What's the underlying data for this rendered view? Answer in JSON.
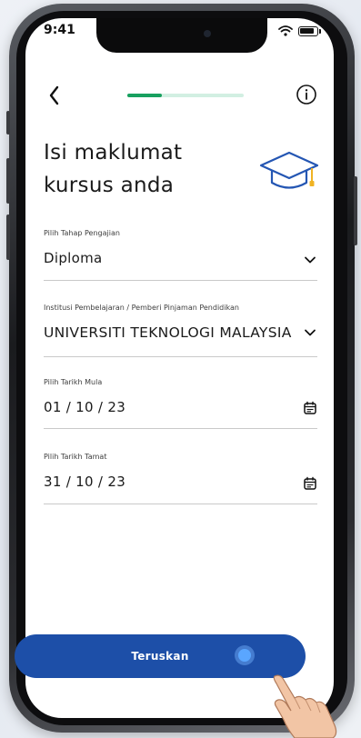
{
  "status_bar": {
    "time": "9:41"
  },
  "progress": {
    "fraction": 0.3
  },
  "page": {
    "title": "Isi maklumat\nkursus anda"
  },
  "fields": [
    {
      "label": "Pilih Tahap Pengajian",
      "value": "Diploma",
      "trailing": "chevron-down-icon"
    },
    {
      "label": "Institusi Pembelajaran / Pemberi Pinjaman Pendidikan",
      "value": "UNIVERSITI TEKNOLOGI MALAYSIA",
      "trailing": "chevron-down-icon"
    },
    {
      "label": "Pilih Tarikh Mula",
      "value": "01 / 10 / 23",
      "trailing": "calendar-icon"
    },
    {
      "label": "Pilih Tarikh Tamat",
      "value": "31 / 10 / 23",
      "trailing": "calendar-icon"
    }
  ],
  "cta": {
    "label": "Teruskan"
  },
  "colors": {
    "primary": "#1d4fa8",
    "progress": "#18a05f",
    "progress_track": "#d2efe2",
    "cap_blue": "#2456b3",
    "cap_tassel": "#f0b323"
  }
}
